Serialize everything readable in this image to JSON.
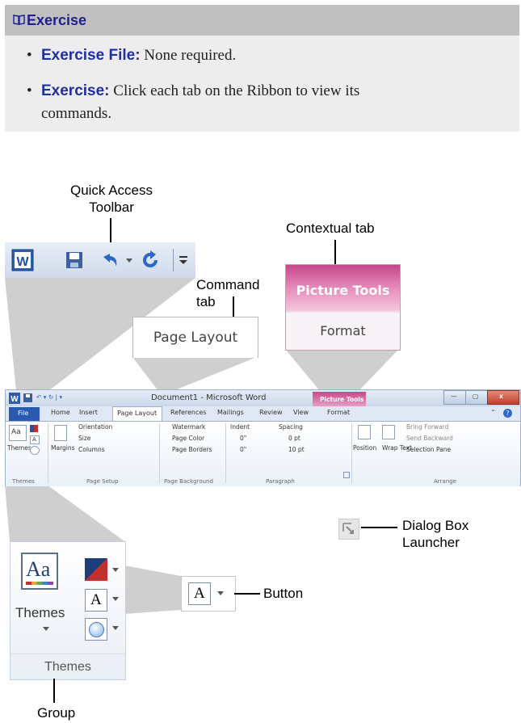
{
  "exercise": {
    "header": "Exercise",
    "items": [
      {
        "label": "Exercise File:",
        "text": "None required."
      },
      {
        "label": "Exercise:",
        "text_line1": "Click each tab on the Ribbon to view its",
        "text_line2": "commands."
      }
    ]
  },
  "callouts": {
    "qat_line1": "Quick Access",
    "qat_line2": "Toolbar",
    "contextual": "Contextual tab",
    "command_line1": "Command",
    "command_line2": "tab",
    "dialog_line1": "Dialog Box",
    "dialog_line2": "Launcher",
    "button": "Button",
    "group": "Group"
  },
  "zoom": {
    "page_layout": "Page Layout",
    "picture_tools": "Picture Tools",
    "format": "Format",
    "themes": "Themes",
    "themes_group": "Themes"
  },
  "ribbon": {
    "doc_title": "Document1 - Microsoft Word",
    "picture_tools": "Picture Tools",
    "tabs": [
      "File",
      "Home",
      "Insert",
      "Page Layout",
      "References",
      "Mailings",
      "Review",
      "View",
      "Format"
    ],
    "themes_btn": "Themes",
    "margins_btn": "Margins",
    "orientation": "Orientation",
    "size": "Size",
    "columns": "Columns",
    "watermark": "Watermark",
    "page_color": "Page Color",
    "page_borders": "Page Borders",
    "indent": "Indent",
    "indent_left": "0\"",
    "indent_right": "0\"",
    "spacing": "Spacing",
    "spacing_before": "0 pt",
    "spacing_after": "10 pt",
    "position": "Position",
    "wrap_text": "Wrap Text",
    "bring_forward": "Bring Forward",
    "send_backward": "Send Backward",
    "selection_pane": "Selection Pane",
    "groups": [
      "Themes",
      "Page Setup",
      "Page Background",
      "Paragraph",
      "Arrange"
    ]
  },
  "colors": {
    "header_bg": "#c0c0c0",
    "body_bg": "#ededed",
    "accent_text": "#1f2fa0",
    "contextual": "#c5488a"
  }
}
